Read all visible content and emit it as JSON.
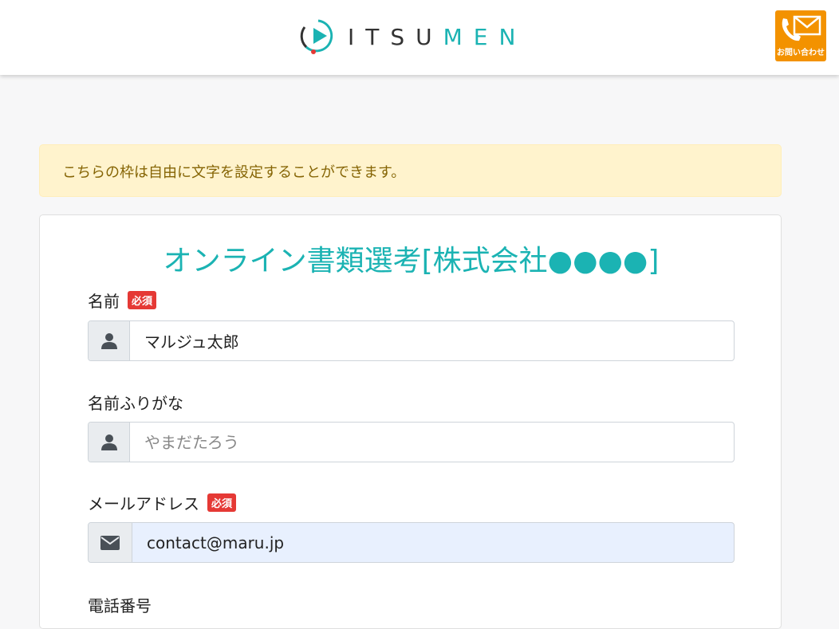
{
  "header": {
    "logo_text_a": "ITSU",
    "logo_text_b": "MEN",
    "contact_label": "お問い合わせ"
  },
  "alert": {
    "text": "こちらの枠は自由に文字を設定することができます。"
  },
  "form": {
    "title": "オンライン書類選考[株式会社●●●●]",
    "required_badge": "必須",
    "fields": [
      {
        "label": "名前",
        "value": "マルジュ太郎",
        "placeholder": ""
      },
      {
        "label": "名前ふりがな",
        "value": "",
        "placeholder": "やまだたろう"
      },
      {
        "label": "メールアドレス",
        "value": "contact@maru.jp",
        "placeholder": ""
      },
      {
        "label": "電話番号"
      }
    ]
  },
  "colors": {
    "brand_teal": "#1bb3b3",
    "contact_orange": "#f39200",
    "required_red": "#e53935",
    "alert_bg": "#fff3cd"
  },
  "icons": [
    "play-logo-icon",
    "phone-mail-icon",
    "user-icon",
    "envelope-icon"
  ]
}
